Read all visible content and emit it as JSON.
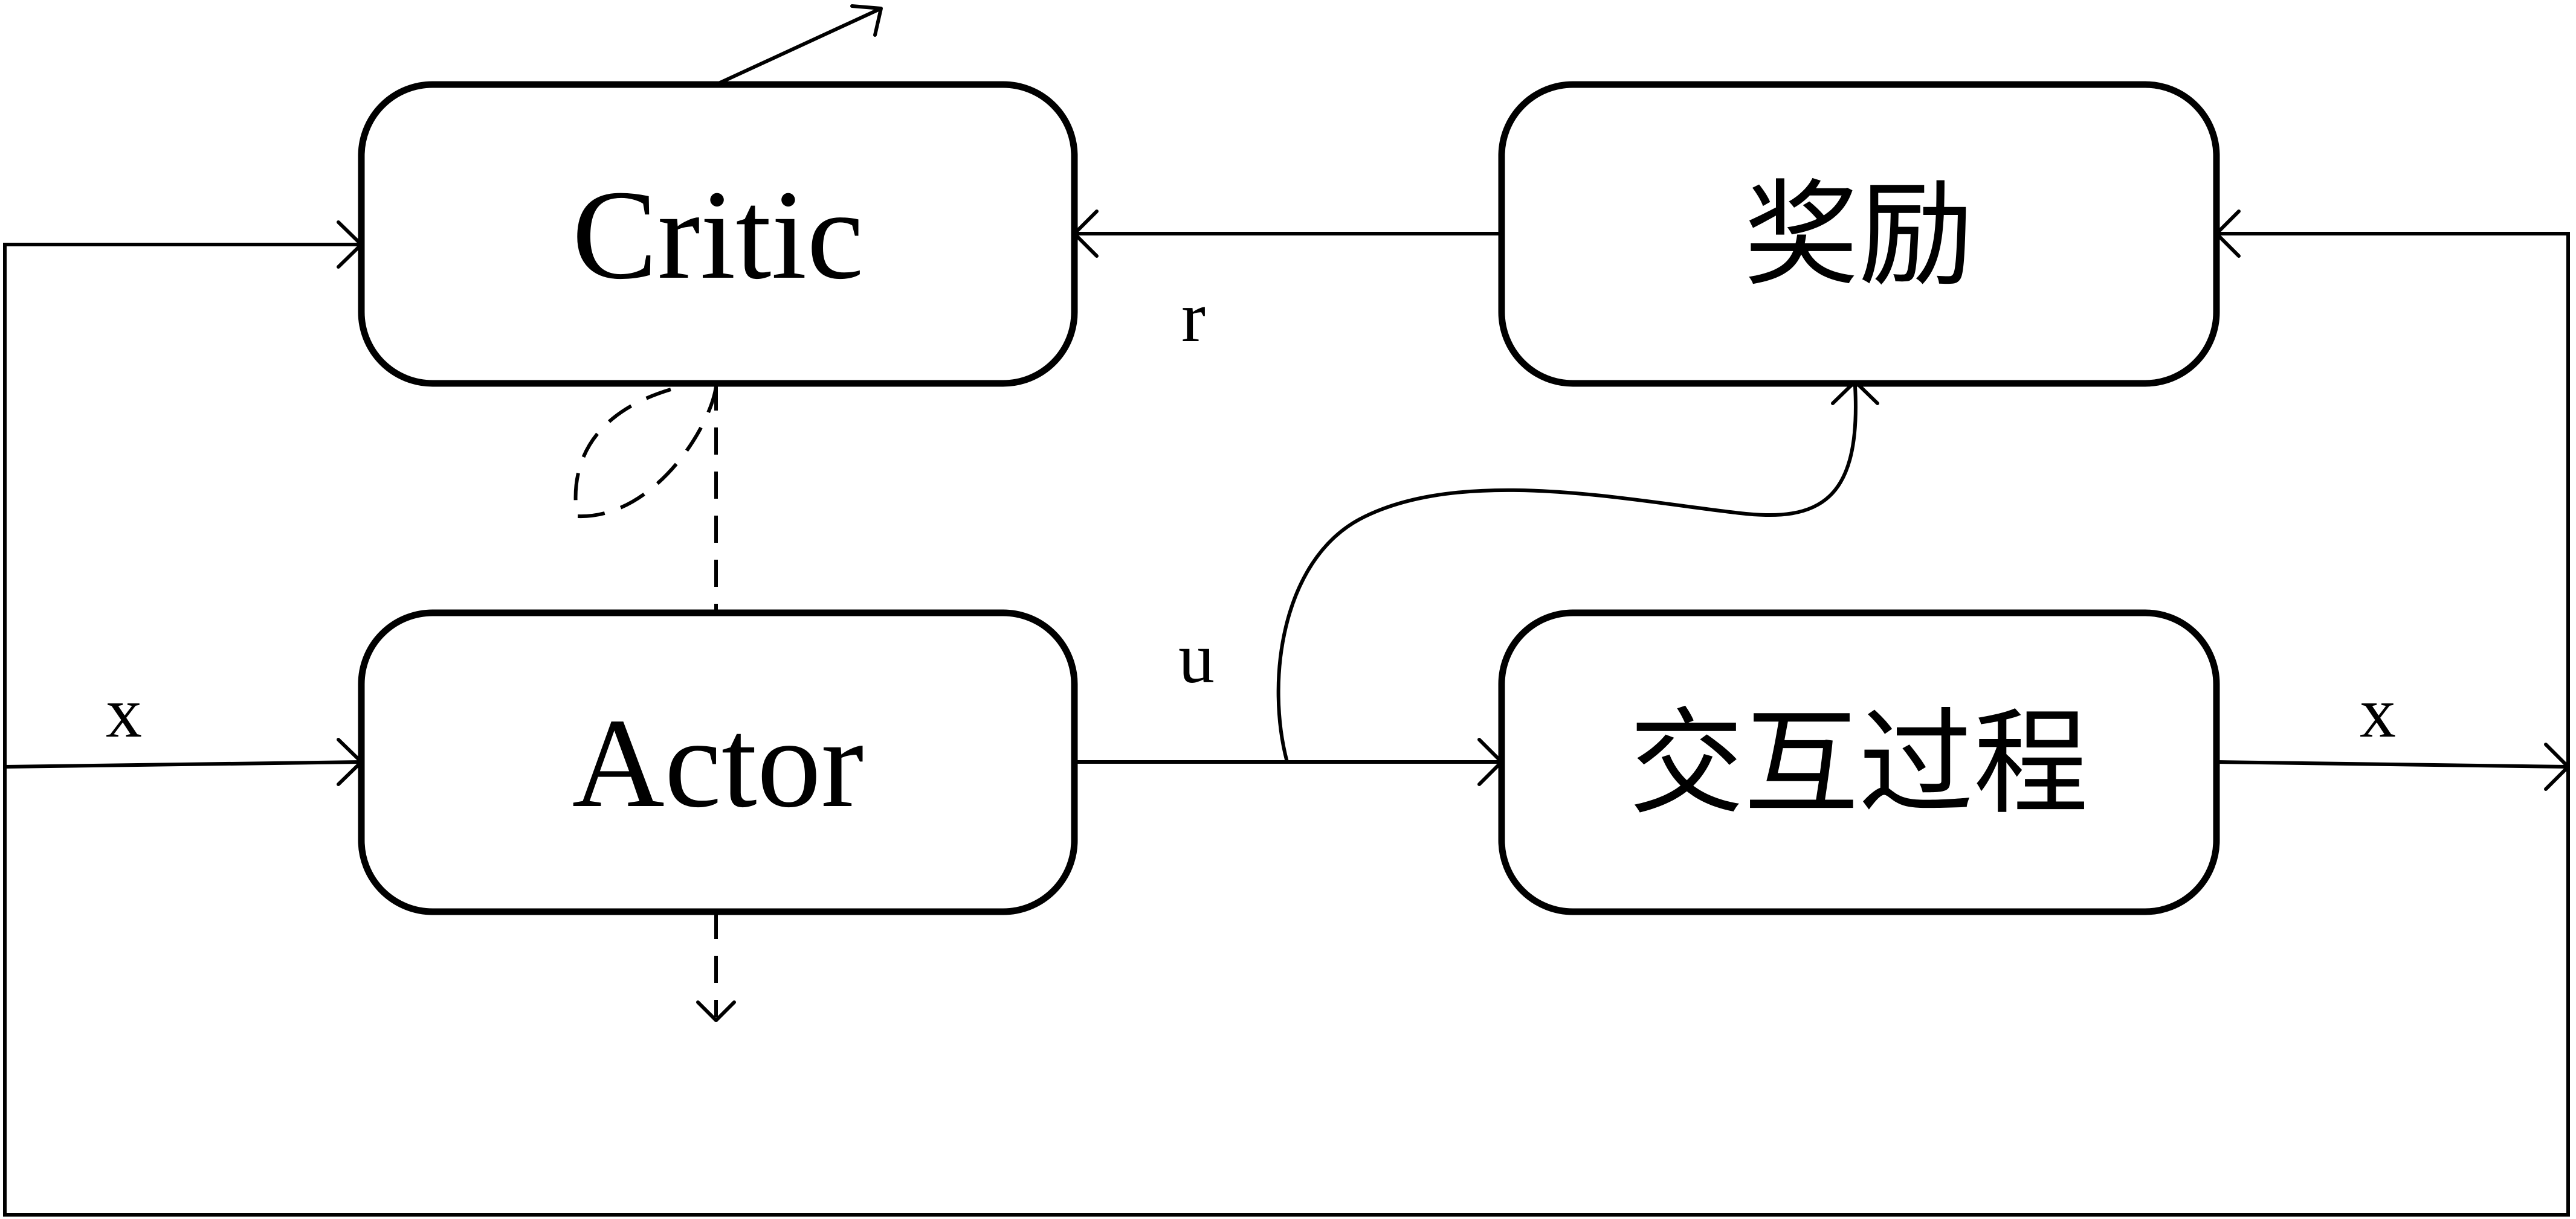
{
  "blocks": {
    "critic": "Critic",
    "actor": "Actor",
    "reward": "奖励",
    "interaction": "交互过程"
  },
  "signals": {
    "r": "r",
    "u": "u",
    "x_in": "x",
    "x_out": "x"
  }
}
